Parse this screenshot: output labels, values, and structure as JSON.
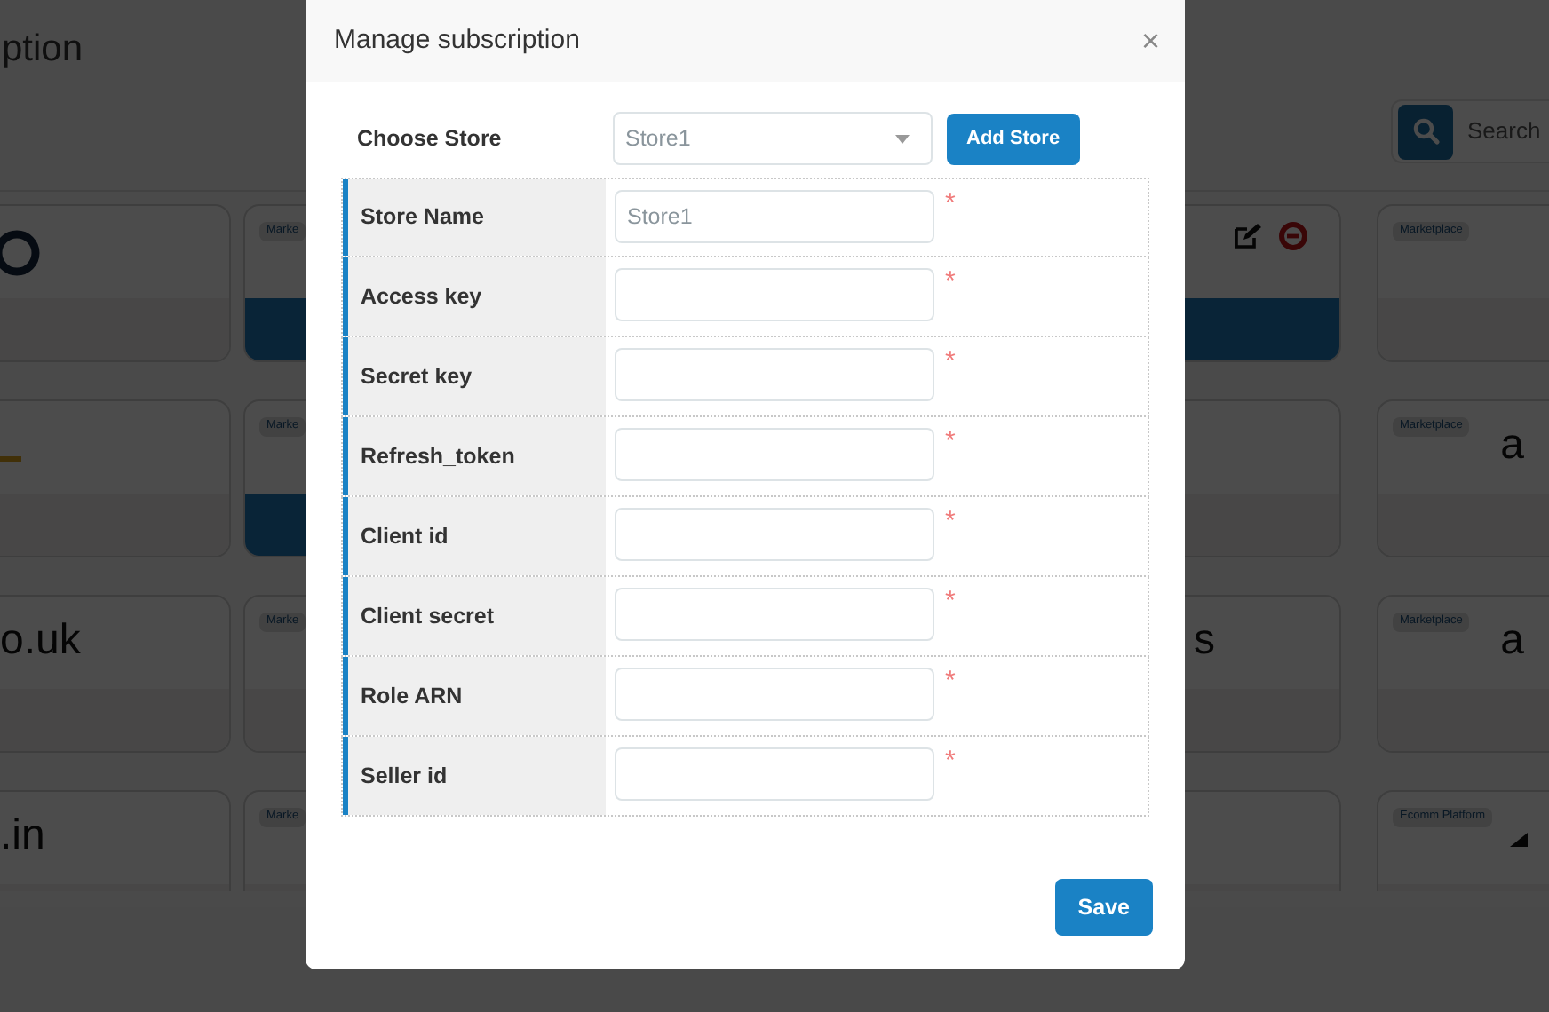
{
  "page": {
    "title": "ption",
    "search": {
      "placeholder": "Search"
    },
    "columns": [
      {
        "cards": [
          {
            "kind": "ring",
            "highlighted": false
          },
          {
            "kind": "orange-mark",
            "highlighted": false
          },
          {
            "logo_text": "o.uk",
            "highlighted": false
          },
          {
            "logo_text": ".in",
            "highlighted": false
          }
        ]
      },
      {
        "cards": [
          {
            "badge": "Marke",
            "highlighted": true
          },
          {
            "badge": "Marke",
            "highlighted": true
          },
          {
            "badge": "Marke",
            "highlighted": false
          },
          {
            "badge": "Marke",
            "highlighted": false
          }
        ]
      },
      {
        "cards": [
          {
            "actions": true,
            "highlighted": true
          },
          {
            "highlighted": false
          },
          {
            "logo_text": "s",
            "highlighted": false
          },
          {
            "highlighted": false
          }
        ]
      },
      {
        "cards": [
          {
            "badge": "Marketplace",
            "highlighted": false
          },
          {
            "badge": "Marketplace",
            "logo_text": "a",
            "highlighted": false
          },
          {
            "badge": "Marketplace",
            "logo_text": "a",
            "highlighted": false
          },
          {
            "badge": "Ecomm Platform",
            "kind": "dark-mark",
            "highlighted": false
          }
        ]
      }
    ]
  },
  "modal": {
    "title": "Manage subscription",
    "close": "×",
    "choose_store": {
      "label": "Choose Store",
      "value": "Store1"
    },
    "add_store": "Add Store",
    "fields": [
      {
        "label": "Store Name",
        "placeholder": "Store1",
        "required": true,
        "required_mark": "*"
      },
      {
        "label": "Access key",
        "required": true,
        "required_mark": "*"
      },
      {
        "label": "Secret key",
        "required": true,
        "required_mark": "*"
      },
      {
        "label": "Refresh_token",
        "required": true,
        "required_mark": "*"
      },
      {
        "label": "Client id",
        "required": true,
        "required_mark": "*"
      },
      {
        "label": "Client secret",
        "required": true,
        "required_mark": "*"
      },
      {
        "label": "Role ARN",
        "required": true,
        "required_mark": "*"
      },
      {
        "label": "Seller id",
        "required": true,
        "required_mark": "*"
      }
    ],
    "save": "Save"
  }
}
